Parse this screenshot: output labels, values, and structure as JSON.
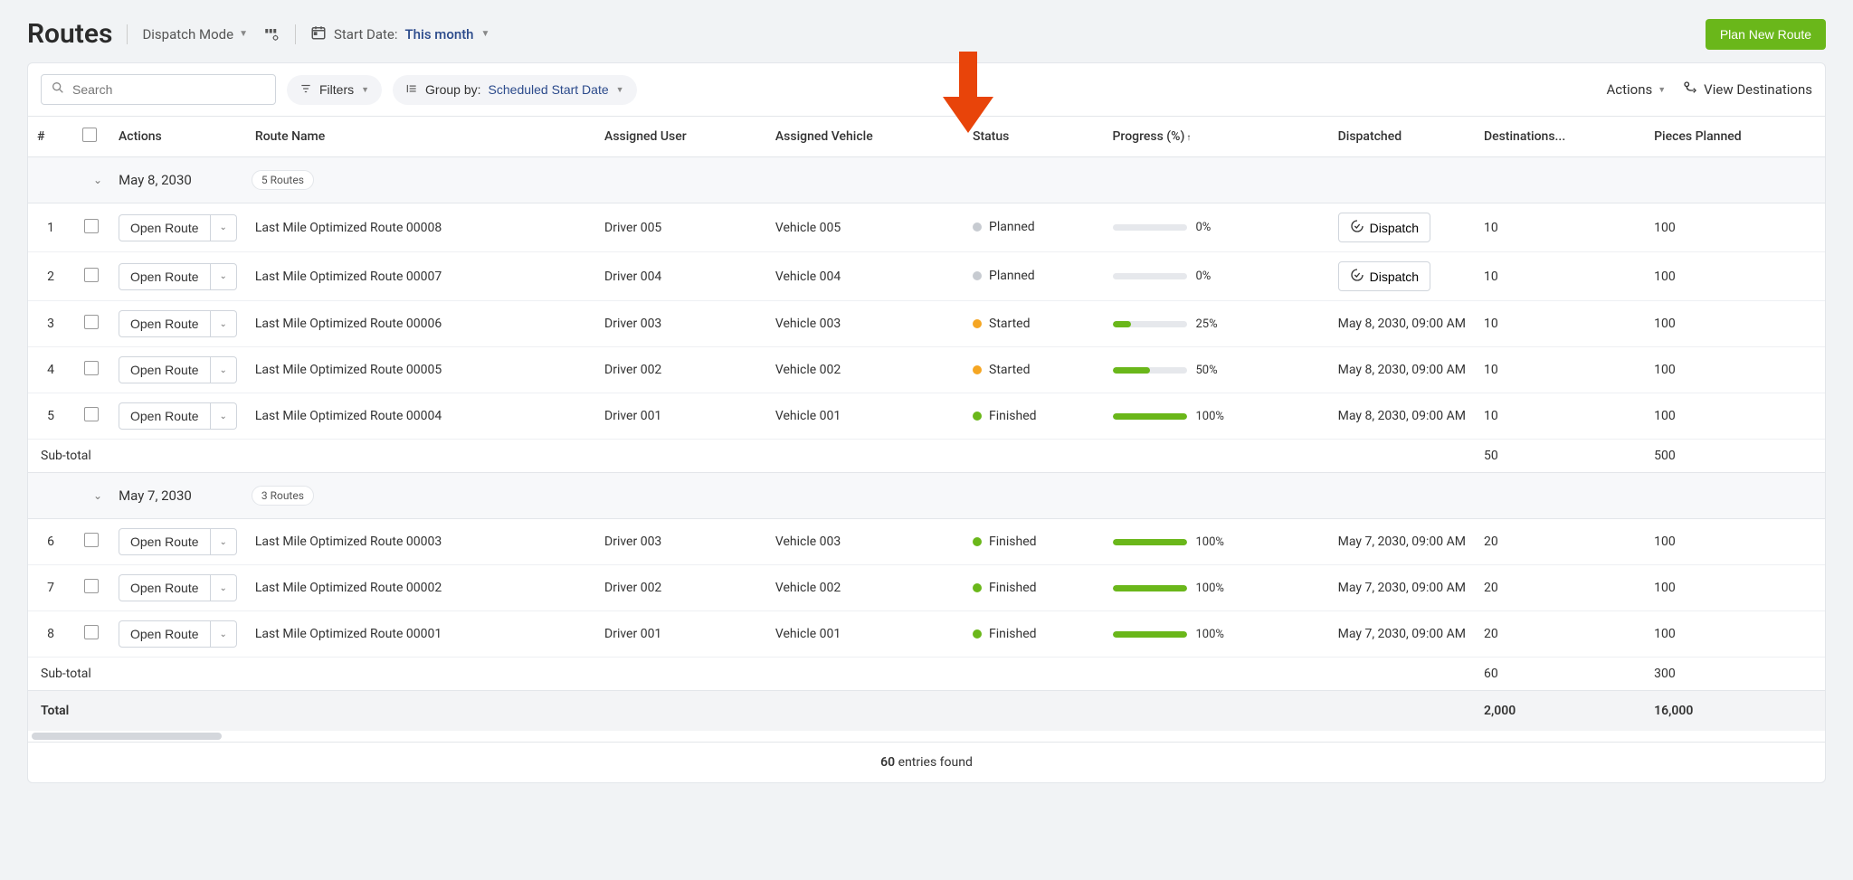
{
  "header": {
    "title": "Routes",
    "mode_label": "Dispatch Mode",
    "start_date_prefix": "Start Date:",
    "start_date_value": "This month",
    "plan_btn": "Plan New Route"
  },
  "toolbar": {
    "search_placeholder": "Search",
    "filters_label": "Filters",
    "group_by_prefix": "Group by:",
    "group_by_value": "Scheduled Start Date",
    "actions_label": "Actions",
    "view_dest_label": "View Destinations"
  },
  "columns": {
    "num": "#",
    "actions": "Actions",
    "route_name": "Route Name",
    "assigned_user": "Assigned User",
    "assigned_vehicle": "Assigned Vehicle",
    "status": "Status",
    "progress": "Progress (%)",
    "dispatched": "Dispatched",
    "destinations": "Destinations...",
    "pieces": "Pieces Planned"
  },
  "open_route_label": "Open Route",
  "dispatch_label": "Dispatch",
  "subtotal_label": "Sub-total",
  "total_label": "Total",
  "groups": [
    {
      "date": "May 8, 2030",
      "badge": "5 Routes",
      "rows": [
        {
          "num": "1",
          "name": "Last Mile Optimized Route 00008",
          "user": "Driver 005",
          "veh": "Vehicle 005",
          "status": "Planned",
          "dot": "grey",
          "pct": 0,
          "disp": "",
          "disp_btn": true,
          "dest": "10",
          "pieces": "100"
        },
        {
          "num": "2",
          "name": "Last Mile Optimized Route 00007",
          "user": "Driver 004",
          "veh": "Vehicle 004",
          "status": "Planned",
          "dot": "grey",
          "pct": 0,
          "disp": "",
          "disp_btn": true,
          "dest": "10",
          "pieces": "100"
        },
        {
          "num": "3",
          "name": "Last Mile Optimized Route 00006",
          "user": "Driver 003",
          "veh": "Vehicle 003",
          "status": "Started",
          "dot": "orange",
          "pct": 25,
          "disp": "May 8, 2030, 09:00 AM",
          "disp_btn": false,
          "dest": "10",
          "pieces": "100"
        },
        {
          "num": "4",
          "name": "Last Mile Optimized Route 00005",
          "user": "Driver 002",
          "veh": "Vehicle 002",
          "status": "Started",
          "dot": "orange",
          "pct": 50,
          "disp": "May 8, 2030, 09:00 AM",
          "disp_btn": false,
          "dest": "10",
          "pieces": "100"
        },
        {
          "num": "5",
          "name": "Last Mile Optimized Route 00004",
          "user": "Driver 001",
          "veh": "Vehicle 001",
          "status": "Finished",
          "dot": "green",
          "pct": 100,
          "disp": "May 8, 2030, 09:00 AM",
          "disp_btn": false,
          "dest": "10",
          "pieces": "100"
        }
      ],
      "sub_dest": "50",
      "sub_pieces": "500"
    },
    {
      "date": "May 7, 2030",
      "badge": "3 Routes",
      "rows": [
        {
          "num": "6",
          "name": "Last Mile Optimized Route 00003",
          "user": "Driver 003",
          "veh": "Vehicle 003",
          "status": "Finished",
          "dot": "green",
          "pct": 100,
          "disp": "May 7, 2030, 09:00 AM",
          "disp_btn": false,
          "dest": "20",
          "pieces": "100"
        },
        {
          "num": "7",
          "name": "Last Mile Optimized Route 00002",
          "user": "Driver 002",
          "veh": "Vehicle 002",
          "status": "Finished",
          "dot": "green",
          "pct": 100,
          "disp": "May 7, 2030, 09:00 AM",
          "disp_btn": false,
          "dest": "20",
          "pieces": "100"
        },
        {
          "num": "8",
          "name": "Last Mile Optimized Route 00001",
          "user": "Driver 001",
          "veh": "Vehicle 001",
          "status": "Finished",
          "dot": "green",
          "pct": 100,
          "disp": "May 7, 2030, 09:00 AM",
          "disp_btn": false,
          "dest": "20",
          "pieces": "100"
        }
      ],
      "sub_dest": "60",
      "sub_pieces": "300"
    }
  ],
  "totals": {
    "dest": "2,000",
    "pieces": "16,000"
  },
  "footer": {
    "count": "60",
    "suffix": "entries found"
  }
}
